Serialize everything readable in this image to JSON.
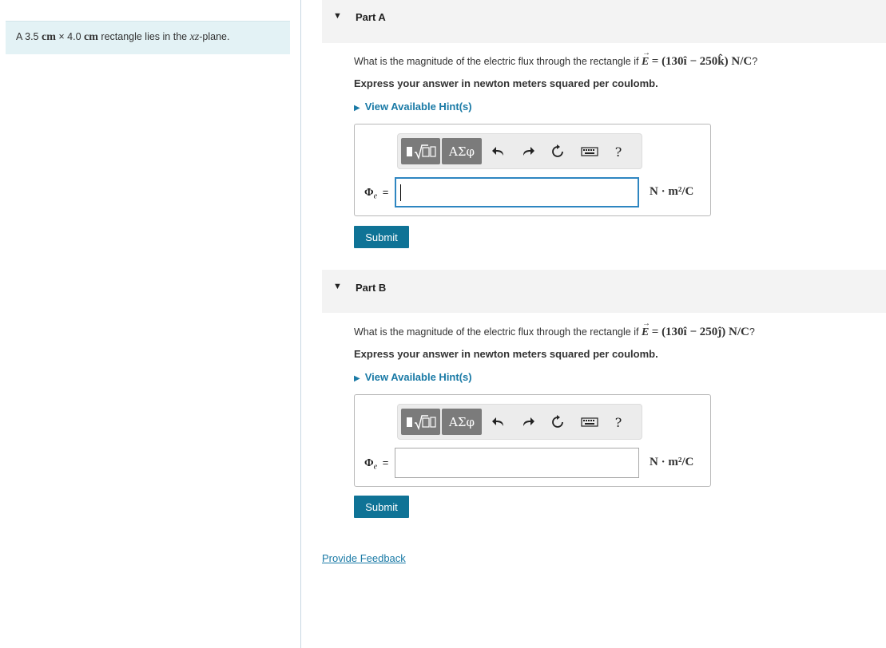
{
  "problem": {
    "prefix": "A 3.5",
    "unit1": "cm",
    "times": "×",
    "mid": "4.0",
    "unit2": "cm",
    "middle_text": "rectangle lies in the",
    "plane_var": "xz",
    "suffix": "-plane."
  },
  "parts": [
    {
      "title": "Part A",
      "question_text": "What is the magnitude of the electric flux through the rectangle if",
      "field_symbol": "E",
      "equation": "= (130î − 250k̂) N/C",
      "question_end": "?",
      "express": "Express your answer in newton meters squared per coulomb.",
      "hint_label": "View Available Hint(s)",
      "phi_symbol": "Φ",
      "phi_sub": "e",
      "equals": "=",
      "units": "N · m²/C",
      "submit_label": "Submit"
    },
    {
      "title": "Part B",
      "question_text": "What is the magnitude of the electric flux through the rectangle if",
      "field_symbol": "E",
      "equation": "= (130î − 250ĵ) N/C",
      "question_end": "?",
      "express": "Express your answer in newton meters squared per coulomb.",
      "hint_label": "View Available Hint(s)",
      "phi_symbol": "Φ",
      "phi_sub": "e",
      "equals": "=",
      "units": "N · m²/C",
      "submit_label": "Submit"
    }
  ],
  "toolbar": {
    "greek_label": "ΑΣφ",
    "help_label": "?",
    "icons": [
      "templates-icon",
      "greek-letters-icon",
      "undo-icon",
      "redo-icon",
      "reset-icon",
      "keyboard-icon",
      "help-icon"
    ]
  },
  "feedback_label": "Provide Feedback"
}
